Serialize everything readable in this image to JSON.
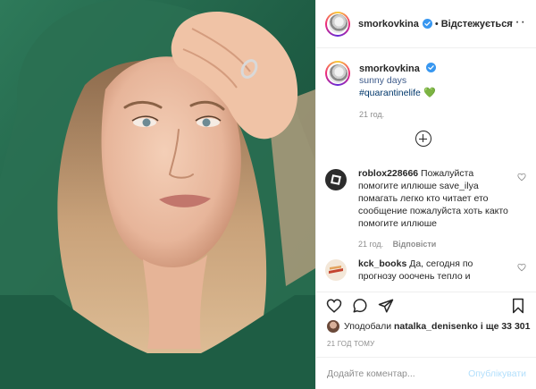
{
  "post": {
    "author": {
      "username": "smorkovkina",
      "verified": true,
      "follow_state": "Відстежується",
      "separator": "•"
    },
    "caption": {
      "username": "smorkovkina",
      "line1": "sunny days",
      "hashtag": "#quarantinelife",
      "emoji": "💚",
      "time": "21 год."
    },
    "comments": [
      {
        "username": "roblox228666",
        "text": "Пожалуйста помогите иллюше save_ilya помагать легко кто читает ето сообщение пожалуйста хоть както помогите иллюше",
        "time": "21 год.",
        "reply_label": "Відповісти"
      },
      {
        "username": "kck_books",
        "text": "Да, сегодня по прогнозу ооочень тепло и",
        "time": "",
        "reply_label": ""
      }
    ],
    "actions": {
      "like_icon": "heart-icon",
      "comment_icon": "comment-icon",
      "share_icon": "send-icon",
      "save_icon": "bookmark-icon"
    },
    "likes": {
      "prefix": "Уподобали",
      "user": "natalka_denisenko",
      "suffix": "і ще 33 301"
    },
    "date": "21 ГОД ТОМУ",
    "add_comment": {
      "placeholder": "Додайте коментар...",
      "post_label": "Опублікувати"
    }
  },
  "colors": {
    "verified_blue": "#3897f0",
    "post_button_disabled": "#b2dffc",
    "hoodie_green": "#1f5a43",
    "muted_text": "#8e8e8e",
    "caption_text": "#3d5a8a",
    "hashtag_text": "#00376b"
  }
}
